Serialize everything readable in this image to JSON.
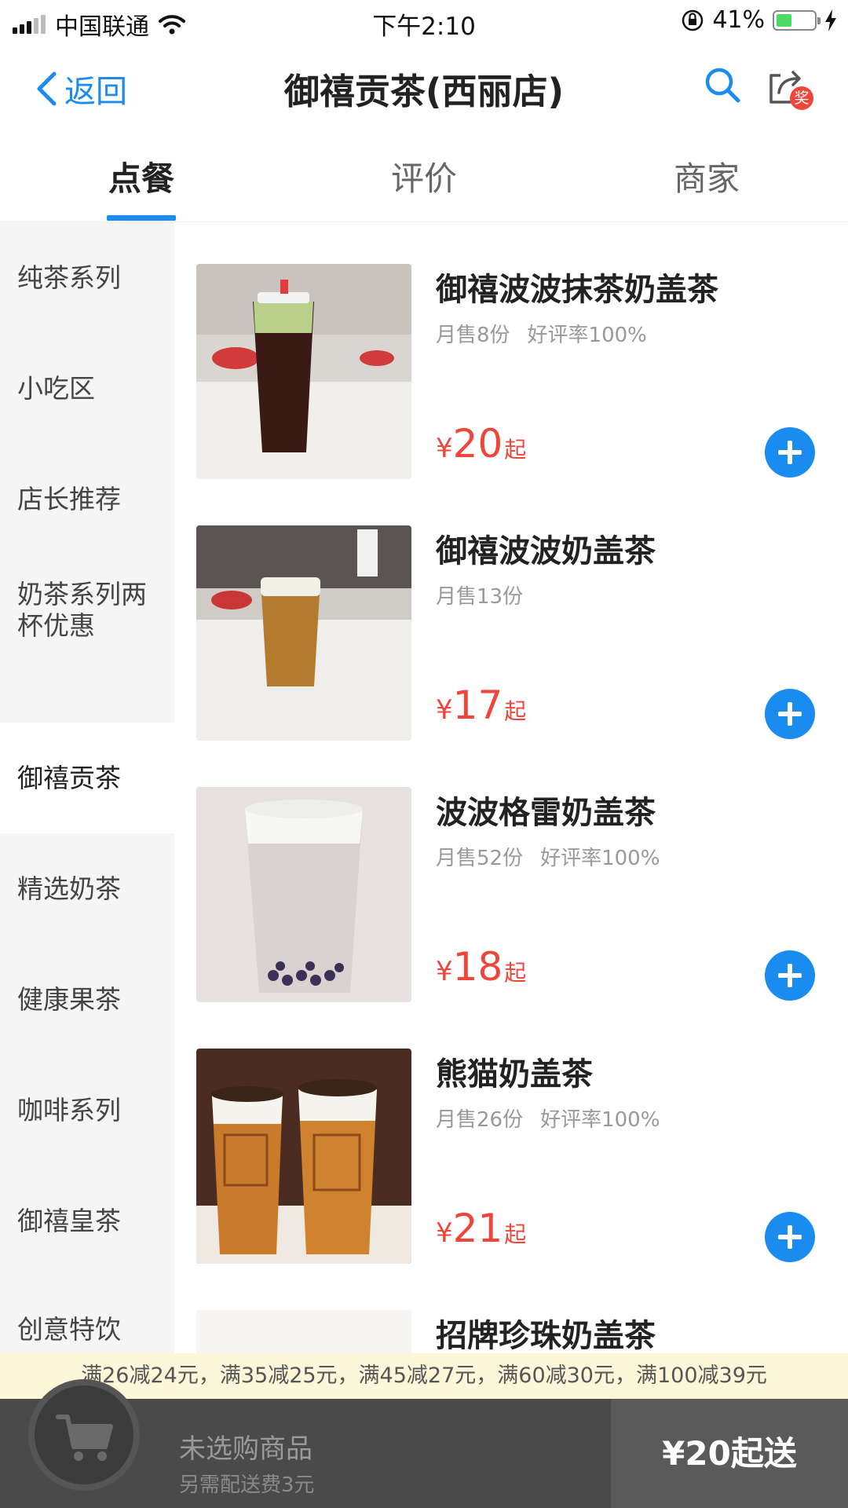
{
  "status_bar": {
    "carrier": "中国联通",
    "time": "下午2:10",
    "battery_text": "41%",
    "battery_level": 0.41
  },
  "nav": {
    "back_label": "返回",
    "title": "御禧贡茶(西丽店)",
    "share_badge": "奖"
  },
  "tabs": [
    {
      "label": "点餐",
      "active": true
    },
    {
      "label": "评价",
      "active": false
    },
    {
      "label": "商家",
      "active": false
    }
  ],
  "categories": [
    {
      "label": "纯茶系列"
    },
    {
      "label": "小吃区"
    },
    {
      "label": "店长推荐"
    },
    {
      "label": "奶茶系列两杯优惠",
      "line1": "奶茶系列两",
      "line2": "杯优惠"
    },
    {
      "label": "御禧贡茶",
      "active": true
    },
    {
      "label": "精选奶茶"
    },
    {
      "label": "健康果茶"
    },
    {
      "label": "咖啡系列"
    },
    {
      "label": "御禧皇茶"
    },
    {
      "label": "创意特饮"
    }
  ],
  "products": [
    {
      "name": "御禧波波抹茶奶盖茶",
      "sales": "月售8份",
      "rating": "好评率100%",
      "currency": "¥",
      "price": "20",
      "suffix": "起"
    },
    {
      "name": "御禧波波奶盖茶",
      "sales": "月售13份",
      "rating": "",
      "currency": "¥",
      "price": "17",
      "suffix": "起"
    },
    {
      "name": "波波格雷奶盖茶",
      "sales": "月售52份",
      "rating": "好评率100%",
      "currency": "¥",
      "price": "18",
      "suffix": "起"
    },
    {
      "name": "熊猫奶盖茶",
      "sales": "月售26份",
      "rating": "好评率100%",
      "currency": "¥",
      "price": "21",
      "suffix": "起"
    },
    {
      "name": "招牌珍珠奶盖茶"
    }
  ],
  "promo": {
    "text": "满26减24元，满35减25元，满45减27元，满60减30元，满100减39元"
  },
  "cart": {
    "empty_text": "未选购商品",
    "delivery_fee_text": "另需配送费3元",
    "min_order_label": "¥20起送"
  },
  "colors": {
    "accent": "#1a8cf0",
    "price": "#f0453a",
    "sidebar_bg": "#f5f5f5",
    "promo_bg": "#fdf6d8",
    "cart_bg": "#4a4a4a"
  }
}
